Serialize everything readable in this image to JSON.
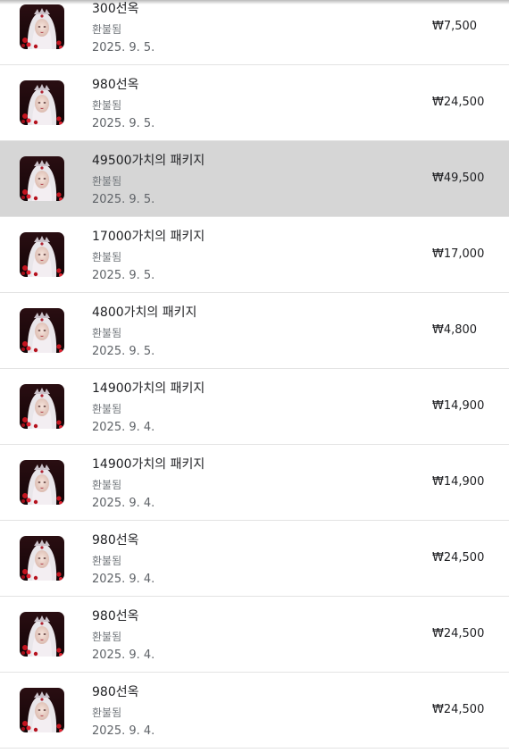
{
  "purchases": [
    {
      "title": "300선옥",
      "status": "환불됨",
      "date": "2025. 9. 5.",
      "price": "₩7,500",
      "icon": "game-character-thumbnail"
    },
    {
      "title": "980선옥",
      "status": "환불됨",
      "date": "2025. 9. 5.",
      "price": "₩24,500",
      "icon": "game-character-thumbnail"
    },
    {
      "title": "49500가치의 패키지",
      "status": "환불됨",
      "date": "2025. 9. 5.",
      "price": "₩49,500",
      "icon": "game-character-thumbnail"
    },
    {
      "title": "17000가치의 패키지",
      "status": "환불됨",
      "date": "2025. 9. 5.",
      "price": "₩17,000",
      "icon": "game-character-thumbnail"
    },
    {
      "title": "4800가치의 패키지",
      "status": "환불됨",
      "date": "2025. 9. 5.",
      "price": "₩4,800",
      "icon": "game-character-thumbnail"
    },
    {
      "title": "14900가치의 패키지",
      "status": "환불됨",
      "date": "2025. 9. 4.",
      "price": "₩14,900",
      "icon": "game-character-thumbnail"
    },
    {
      "title": "14900가치의 패키지",
      "status": "환불됨",
      "date": "2025. 9. 4.",
      "price": "₩14,900",
      "icon": "game-character-thumbnail"
    },
    {
      "title": "980선옥",
      "status": "환불됨",
      "date": "2025. 9. 4.",
      "price": "₩24,500",
      "icon": "game-character-thumbnail"
    },
    {
      "title": "980선옥",
      "status": "환불됨",
      "date": "2025. 9. 4.",
      "price": "₩24,500",
      "icon": "game-character-thumbnail"
    },
    {
      "title": "980선옥",
      "status": "환불됨",
      "date": "2025. 9. 4.",
      "price": "₩24,500",
      "icon": "game-character-thumbnail"
    }
  ],
  "selected_index": 2,
  "colors": {
    "selected_row": "#d6d6d6",
    "divider": "#e3e3e3",
    "title_text": "#202124",
    "secondary_text": "#70757a"
  }
}
